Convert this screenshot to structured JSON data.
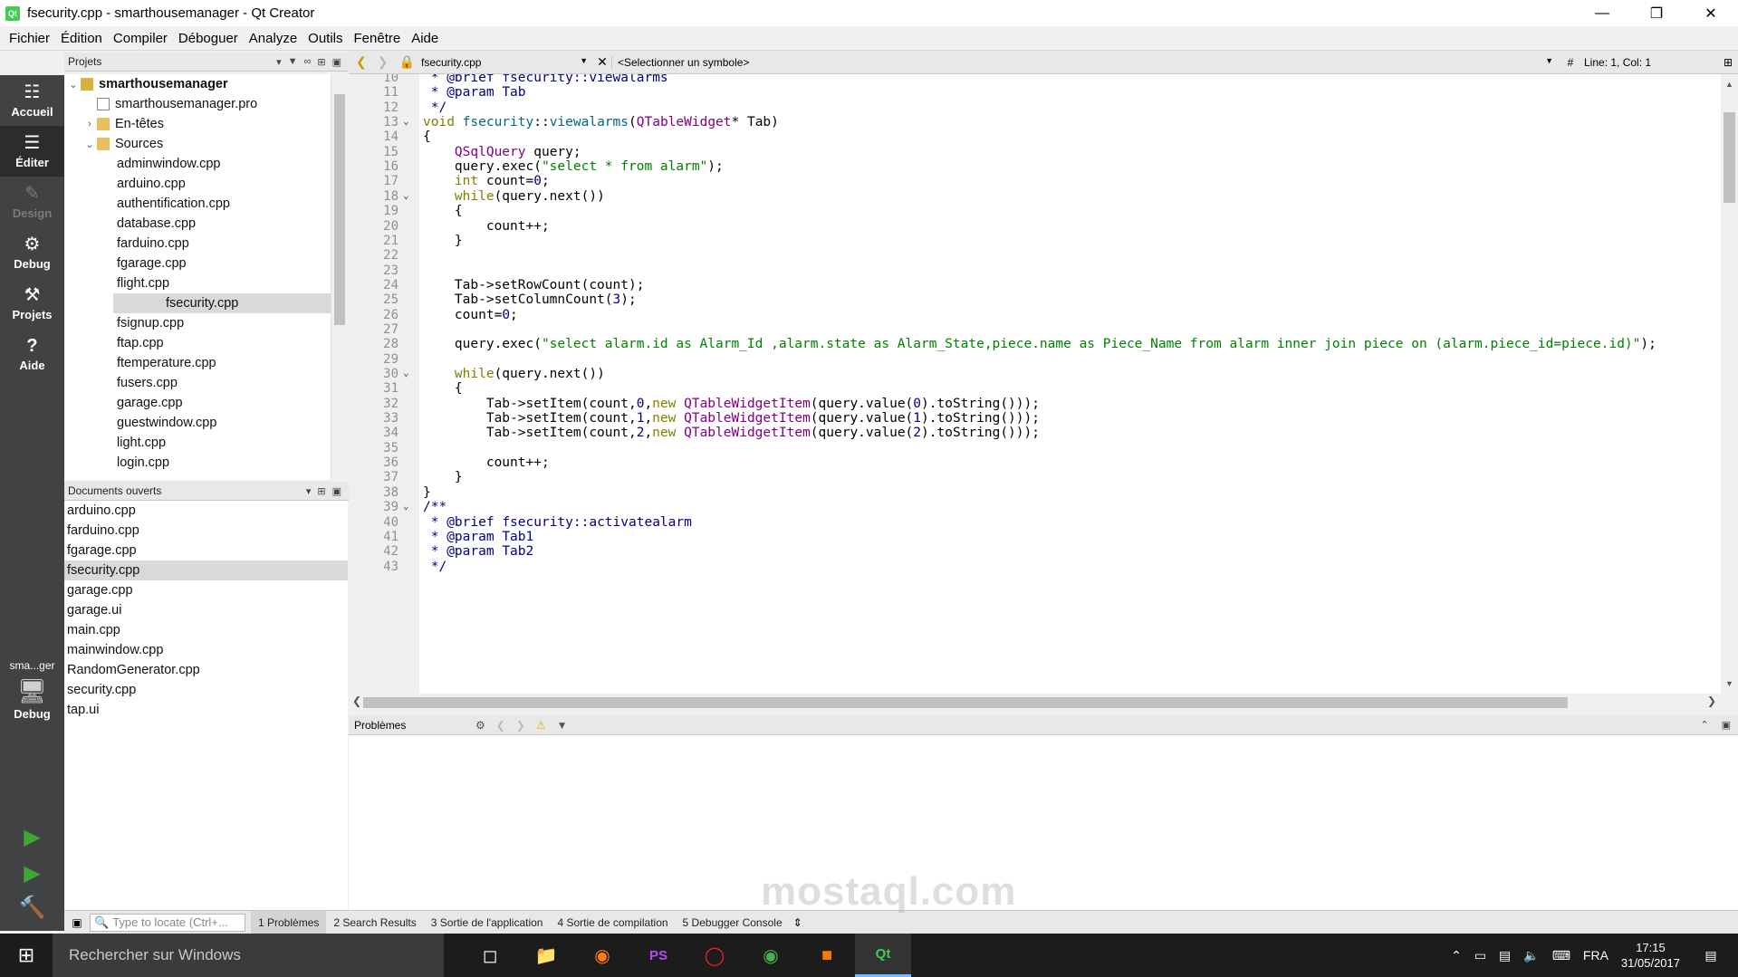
{
  "window": {
    "title": "fsecurity.cpp - smarthousemanager - Qt Creator",
    "app_icon": "qt-creator-icon",
    "controls": [
      "minimize",
      "restore",
      "close"
    ]
  },
  "menubar": [
    "Fichier",
    "Édition",
    "Compiler",
    "Déboguer",
    "Analyze",
    "Outils",
    "Fenêtre",
    "Aide"
  ],
  "modes": [
    {
      "label": "Accueil",
      "icon": "grid-icon",
      "state": "normal"
    },
    {
      "label": "Éditer",
      "icon": "edit-icon",
      "state": "active"
    },
    {
      "label": "Design",
      "icon": "pencil-icon",
      "state": "disabled"
    },
    {
      "label": "Debug",
      "icon": "bug-icon",
      "state": "normal"
    },
    {
      "label": "Projets",
      "icon": "wrench-icon",
      "state": "normal"
    },
    {
      "label": "Aide",
      "icon": "help-icon",
      "state": "normal"
    }
  ],
  "target": {
    "kit": "sma...ger",
    "config": "Debug"
  },
  "projects_pane": {
    "header": "Projets",
    "tree": [
      {
        "label": "smarthousemanager",
        "level": 0,
        "arrow": "down",
        "type": "project",
        "bold": true
      },
      {
        "label": "smarthousemanager.pro",
        "level": 1,
        "arrow": "",
        "type": "pro"
      },
      {
        "label": "En-têtes",
        "level": 1,
        "arrow": "right",
        "type": "folder"
      },
      {
        "label": "Sources",
        "level": 1,
        "arrow": "down",
        "type": "folder"
      },
      {
        "label": "adminwindow.cpp",
        "level": 2,
        "type": "file"
      },
      {
        "label": "arduino.cpp",
        "level": 2,
        "type": "file"
      },
      {
        "label": "authentification.cpp",
        "level": 2,
        "type": "file"
      },
      {
        "label": "database.cpp",
        "level": 2,
        "type": "file"
      },
      {
        "label": "farduino.cpp",
        "level": 2,
        "type": "file"
      },
      {
        "label": "fgarage.cpp",
        "level": 2,
        "type": "file"
      },
      {
        "label": "flight.cpp",
        "level": 2,
        "type": "file"
      },
      {
        "label": "fsecurity.cpp",
        "level": 2,
        "type": "file",
        "selected": true
      },
      {
        "label": "fsignup.cpp",
        "level": 2,
        "type": "file"
      },
      {
        "label": "ftap.cpp",
        "level": 2,
        "type": "file"
      },
      {
        "label": "ftemperature.cpp",
        "level": 2,
        "type": "file"
      },
      {
        "label": "fusers.cpp",
        "level": 2,
        "type": "file"
      },
      {
        "label": "garage.cpp",
        "level": 2,
        "type": "file"
      },
      {
        "label": "guestwindow.cpp",
        "level": 2,
        "type": "file"
      },
      {
        "label": "light.cpp",
        "level": 2,
        "type": "file"
      },
      {
        "label": "login.cpp",
        "level": 2,
        "type": "file"
      }
    ]
  },
  "open_docs": {
    "header": "Documents ouverts",
    "items": [
      "arduino.cpp",
      "farduino.cpp",
      "fgarage.cpp",
      "fsecurity.cpp",
      "garage.cpp",
      "garage.ui",
      "main.cpp",
      "mainwindow.cpp",
      "RandomGenerator.cpp",
      "security.cpp",
      "tap.ui"
    ],
    "selected_index": 3
  },
  "editor_toolbar": {
    "file": "fsecurity.cpp",
    "symbol": "<Selectionner un symbole>",
    "hash": "#",
    "linecol": "Line: 1, Col: 1"
  },
  "code_lines": [
    {
      "n": "10",
      "fold": "",
      "html": " <span class=\"cm\">* <span class=\"dx\">@brief</span> fsecurity::viewalarms</span>"
    },
    {
      "n": "11",
      "fold": "",
      "html": " <span class=\"cm\">* <span class=\"dx\">@param</span> Tab</span>"
    },
    {
      "n": "12",
      "fold": "",
      "html": " <span class=\"cm\">*/</span>"
    },
    {
      "n": "13",
      "fold": "v",
      "html": "<span class=\"kw\">void</span> <span class=\"fn\">fsecurity</span>::<span class=\"fn\">viewalarms</span>(<span class=\"ty\">QTableWidget</span>* Tab)"
    },
    {
      "n": "14",
      "fold": "",
      "html": "{"
    },
    {
      "n": "15",
      "fold": "",
      "html": "    <span class=\"ty\">QSqlQuery</span> query;"
    },
    {
      "n": "16",
      "fold": "",
      "html": "    query.exec(<span class=\"st\">\"select * from alarm\"</span>);"
    },
    {
      "n": "17",
      "fold": "",
      "html": "    <span class=\"kw\">int</span> count=<span class=\"nm\">0</span>;"
    },
    {
      "n": "18",
      "fold": "v",
      "html": "    <span class=\"kw\">while</span>(query.next())"
    },
    {
      "n": "19",
      "fold": "",
      "html": "    {"
    },
    {
      "n": "20",
      "fold": "",
      "html": "        count++;"
    },
    {
      "n": "21",
      "fold": "",
      "html": "    }"
    },
    {
      "n": "22",
      "fold": "",
      "html": ""
    },
    {
      "n": "23",
      "fold": "",
      "html": ""
    },
    {
      "n": "24",
      "fold": "",
      "html": "    Tab->setRowCount(count);"
    },
    {
      "n": "25",
      "fold": "",
      "html": "    Tab->setColumnCount(<span class=\"nm\">3</span>);"
    },
    {
      "n": "26",
      "fold": "",
      "html": "    count=<span class=\"nm\">0</span>;"
    },
    {
      "n": "27",
      "fold": "",
      "html": ""
    },
    {
      "n": "28",
      "fold": "",
      "html": "    query.exec(<span class=\"st\">\"select alarm.id as Alarm_Id ,alarm.state as Alarm_State,piece.name as Piece_Name from alarm inner join piece on (alarm.piece_id=piece.id)\"</span>);"
    },
    {
      "n": "29",
      "fold": "",
      "html": ""
    },
    {
      "n": "30",
      "fold": "v",
      "html": "    <span class=\"kw\">while</span>(query.next())"
    },
    {
      "n": "31",
      "fold": "",
      "html": "    {"
    },
    {
      "n": "32",
      "fold": "",
      "html": "        Tab->setItem(count,<span class=\"nm\">0</span>,<span class=\"kw\">new</span> <span class=\"ty\">QTableWidgetItem</span>(query.value(<span class=\"nm\">0</span>).toString()));"
    },
    {
      "n": "33",
      "fold": "",
      "html": "        Tab->setItem(count,<span class=\"nm\">1</span>,<span class=\"kw\">new</span> <span class=\"ty\">QTableWidgetItem</span>(query.value(<span class=\"nm\">1</span>).toString()));"
    },
    {
      "n": "34",
      "fold": "",
      "html": "        Tab->setItem(count,<span class=\"nm\">2</span>,<span class=\"kw\">new</span> <span class=\"ty\">QTableWidgetItem</span>(query.value(<span class=\"nm\">2</span>).toString()));"
    },
    {
      "n": "35",
      "fold": "",
      "html": ""
    },
    {
      "n": "36",
      "fold": "",
      "html": "        count++;"
    },
    {
      "n": "37",
      "fold": "",
      "html": "    }"
    },
    {
      "n": "38",
      "fold": "",
      "html": "}"
    },
    {
      "n": "39",
      "fold": "v",
      "html": "<span class=\"cm\">/**</span>"
    },
    {
      "n": "40",
      "fold": "",
      "html": " <span class=\"cm\">* <span class=\"dx\">@brief</span> fsecurity::activatealarm</span>"
    },
    {
      "n": "41",
      "fold": "",
      "html": " <span class=\"cm\">* <span class=\"dx\">@param</span> Tab1</span>"
    },
    {
      "n": "42",
      "fold": "",
      "html": " <span class=\"cm\">* <span class=\"dx\">@param</span> Tab2</span>"
    },
    {
      "n": "43",
      "fold": "",
      "html": " <span class=\"cm\">*/</span>"
    }
  ],
  "output_pane": {
    "header": "Problèmes"
  },
  "locator": {
    "placeholder": "Type to locate (Ctrl+..."
  },
  "output_tabs": [
    "1  Problèmes",
    "2  Search Results",
    "3  Sortie de l'application",
    "4  Sortie de compilation",
    "5  Debugger Console"
  ],
  "taskbar": {
    "search_placeholder": "Rechercher sur Windows",
    "apps": [
      "task-view-icon",
      "file-explorer-icon",
      "firefox-icon",
      "phpstorm-icon",
      "opera-icon",
      "chrome-icon",
      "orange-icon",
      "qt-creator-icon"
    ],
    "lang": "FRA",
    "time": "17:15",
    "date": "31/05/2017"
  },
  "watermark": "mostaql.com"
}
